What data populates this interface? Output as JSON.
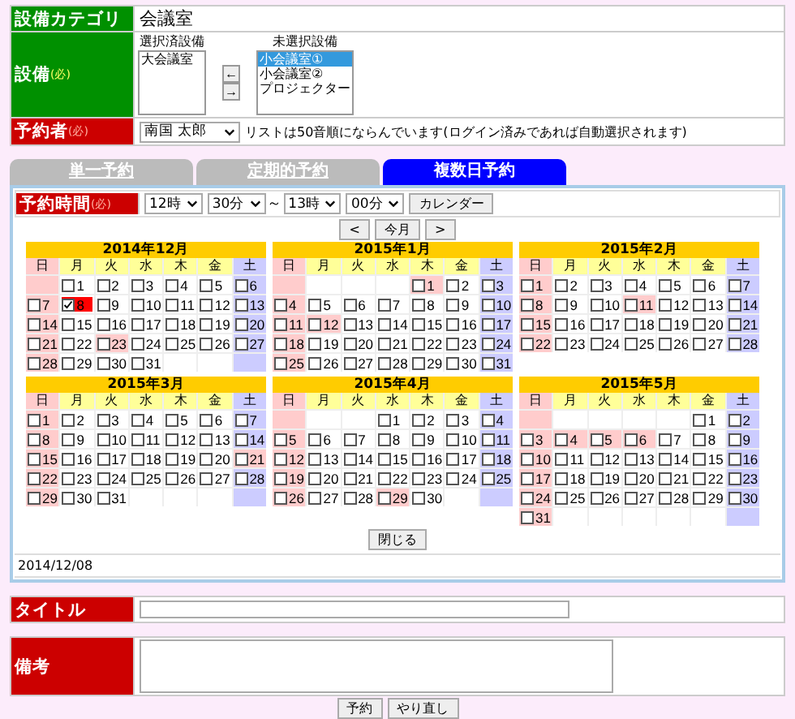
{
  "category": {
    "label": "設備カテゴリ",
    "value": "会議室"
  },
  "equipment": {
    "label": "設備",
    "required": "(必)",
    "selected_heading": "選択済設備",
    "unselected_heading": "未選択設備",
    "selected_list": [
      {
        "label": "大会議室",
        "selected": false
      }
    ],
    "move_buttons": [
      "←",
      "→"
    ],
    "unselected_list": [
      {
        "label": "小会議室①",
        "selected": true
      },
      {
        "label": "小会議室②",
        "selected": false
      },
      {
        "label": "プロジェクター",
        "selected": false
      }
    ]
  },
  "reserver": {
    "label": "予約者",
    "required": "(必)",
    "value": "南国 太郎",
    "note": "リストは50音順にならんでいます(ログイン済みであれば自動選択されます)"
  },
  "tabs": [
    {
      "label": "単一予約",
      "selected": false
    },
    {
      "label": "定期的予約",
      "selected": false
    },
    {
      "label": "複数日予約",
      "selected": true
    }
  ],
  "time": {
    "label": "予約時間",
    "required": "(必)",
    "start_hour": "12時",
    "start_min": "30分",
    "separator": "～",
    "end_hour": "13時",
    "end_min": "00分",
    "calendar_button": "カレンダー"
  },
  "nav": {
    "prev": "<",
    "today": "今月",
    "next": ">"
  },
  "months": [
    {
      "title": "2014年12月",
      "weekdays": [
        "日",
        "月",
        "火",
        "水",
        "木",
        "金",
        "土"
      ],
      "weeks": [
        [
          {
            "kind": "blank",
            "color": "#ffcccc"
          },
          {
            "kind": "day",
            "day": "1",
            "checked": false,
            "color": "#ffffff"
          },
          {
            "kind": "day",
            "day": "2",
            "checked": false,
            "color": "#ffffff"
          },
          {
            "kind": "day",
            "day": "3",
            "checked": false,
            "color": "#ffffff"
          },
          {
            "kind": "day",
            "day": "4",
            "checked": false,
            "color": "#ffffff"
          },
          {
            "kind": "day",
            "day": "5",
            "checked": false,
            "color": "#ffffff"
          },
          {
            "kind": "day",
            "day": "6",
            "checked": false,
            "color": "#ccccff"
          }
        ],
        [
          {
            "kind": "day",
            "day": "7",
            "checked": false,
            "color": "#ffcccc"
          },
          {
            "kind": "day",
            "day": "8",
            "checked": true,
            "color": "#ffffff"
          },
          {
            "kind": "day",
            "day": "9",
            "checked": false,
            "color": "#ffffff"
          },
          {
            "kind": "day",
            "day": "10",
            "checked": false,
            "color": "#ffffff"
          },
          {
            "kind": "day",
            "day": "11",
            "checked": false,
            "color": "#ffffff"
          },
          {
            "kind": "day",
            "day": "12",
            "checked": false,
            "color": "#ffffff"
          },
          {
            "kind": "day",
            "day": "13",
            "checked": false,
            "color": "#ccccff"
          }
        ],
        [
          {
            "kind": "day",
            "day": "14",
            "checked": false,
            "color": "#ffcccc"
          },
          {
            "kind": "day",
            "day": "15",
            "checked": false,
            "color": "#ffffff"
          },
          {
            "kind": "day",
            "day": "16",
            "checked": false,
            "color": "#ffffff"
          },
          {
            "kind": "day",
            "day": "17",
            "checked": false,
            "color": "#ffffff"
          },
          {
            "kind": "day",
            "day": "18",
            "checked": false,
            "color": "#ffffff"
          },
          {
            "kind": "day",
            "day": "19",
            "checked": false,
            "color": "#ffffff"
          },
          {
            "kind": "day",
            "day": "20",
            "checked": false,
            "color": "#ccccff"
          }
        ],
        [
          {
            "kind": "day",
            "day": "21",
            "checked": false,
            "color": "#ffcccc"
          },
          {
            "kind": "day",
            "day": "22",
            "checked": false,
            "color": "#ffffff"
          },
          {
            "kind": "day",
            "day": "23",
            "checked": false,
            "color": "#ffcccc"
          },
          {
            "kind": "day",
            "day": "24",
            "checked": false,
            "color": "#ffffff"
          },
          {
            "kind": "day",
            "day": "25",
            "checked": false,
            "color": "#ffffff"
          },
          {
            "kind": "day",
            "day": "26",
            "checked": false,
            "color": "#ffffff"
          },
          {
            "kind": "day",
            "day": "27",
            "checked": false,
            "color": "#ccccff"
          }
        ],
        [
          {
            "kind": "day",
            "day": "28",
            "checked": false,
            "color": "#ffcccc"
          },
          {
            "kind": "day",
            "day": "29",
            "checked": false,
            "color": "#ffffff"
          },
          {
            "kind": "day",
            "day": "30",
            "checked": false,
            "color": "#ffffff"
          },
          {
            "kind": "day",
            "day": "31",
            "checked": false,
            "color": "#ffffff"
          },
          {
            "kind": "blank",
            "color": "#ffffff"
          },
          {
            "kind": "blank",
            "color": "#ffffff"
          },
          {
            "kind": "blank",
            "color": "#ccccff"
          }
        ]
      ]
    },
    {
      "title": "2015年1月",
      "weekdays": [
        "日",
        "月",
        "火",
        "水",
        "木",
        "金",
        "土"
      ],
      "weeks": [
        [
          {
            "kind": "blank",
            "color": "#ffcccc"
          },
          {
            "kind": "blank",
            "color": "#ffffff"
          },
          {
            "kind": "blank",
            "color": "#ffffff"
          },
          {
            "kind": "blank",
            "color": "#ffffff"
          },
          {
            "kind": "day",
            "day": "1",
            "checked": false,
            "color": "#ffcccc"
          },
          {
            "kind": "day",
            "day": "2",
            "checked": false,
            "color": "#ffffff"
          },
          {
            "kind": "day",
            "day": "3",
            "checked": false,
            "color": "#ccccff"
          }
        ],
        [
          {
            "kind": "day",
            "day": "4",
            "checked": false,
            "color": "#ffcccc"
          },
          {
            "kind": "day",
            "day": "5",
            "checked": false,
            "color": "#ffffff"
          },
          {
            "kind": "day",
            "day": "6",
            "checked": false,
            "color": "#ffffff"
          },
          {
            "kind": "day",
            "day": "7",
            "checked": false,
            "color": "#ffffff"
          },
          {
            "kind": "day",
            "day": "8",
            "checked": false,
            "color": "#ffffff"
          },
          {
            "kind": "day",
            "day": "9",
            "checked": false,
            "color": "#ffffff"
          },
          {
            "kind": "day",
            "day": "10",
            "checked": false,
            "color": "#ccccff"
          }
        ],
        [
          {
            "kind": "day",
            "day": "11",
            "checked": false,
            "color": "#ffcccc"
          },
          {
            "kind": "day",
            "day": "12",
            "checked": false,
            "color": "#ffcccc"
          },
          {
            "kind": "day",
            "day": "13",
            "checked": false,
            "color": "#ffffff"
          },
          {
            "kind": "day",
            "day": "14",
            "checked": false,
            "color": "#ffffff"
          },
          {
            "kind": "day",
            "day": "15",
            "checked": false,
            "color": "#ffffff"
          },
          {
            "kind": "day",
            "day": "16",
            "checked": false,
            "color": "#ffffff"
          },
          {
            "kind": "day",
            "day": "17",
            "checked": false,
            "color": "#ccccff"
          }
        ],
        [
          {
            "kind": "day",
            "day": "18",
            "checked": false,
            "color": "#ffcccc"
          },
          {
            "kind": "day",
            "day": "19",
            "checked": false,
            "color": "#ffffff"
          },
          {
            "kind": "day",
            "day": "20",
            "checked": false,
            "color": "#ffffff"
          },
          {
            "kind": "day",
            "day": "21",
            "checked": false,
            "color": "#ffffff"
          },
          {
            "kind": "day",
            "day": "22",
            "checked": false,
            "color": "#ffffff"
          },
          {
            "kind": "day",
            "day": "23",
            "checked": false,
            "color": "#ffffff"
          },
          {
            "kind": "day",
            "day": "24",
            "checked": false,
            "color": "#ccccff"
          }
        ],
        [
          {
            "kind": "day",
            "day": "25",
            "checked": false,
            "color": "#ffcccc"
          },
          {
            "kind": "day",
            "day": "26",
            "checked": false,
            "color": "#ffffff"
          },
          {
            "kind": "day",
            "day": "27",
            "checked": false,
            "color": "#ffffff"
          },
          {
            "kind": "day",
            "day": "28",
            "checked": false,
            "color": "#ffffff"
          },
          {
            "kind": "day",
            "day": "29",
            "checked": false,
            "color": "#ffffff"
          },
          {
            "kind": "day",
            "day": "30",
            "checked": false,
            "color": "#ffffff"
          },
          {
            "kind": "day",
            "day": "31",
            "checked": false,
            "color": "#ccccff"
          }
        ]
      ]
    },
    {
      "title": "2015年2月",
      "weekdays": [
        "日",
        "月",
        "火",
        "水",
        "木",
        "金",
        "土"
      ],
      "weeks": [
        [
          {
            "kind": "day",
            "day": "1",
            "checked": false,
            "color": "#ffcccc"
          },
          {
            "kind": "day",
            "day": "2",
            "checked": false,
            "color": "#ffffff"
          },
          {
            "kind": "day",
            "day": "3",
            "checked": false,
            "color": "#ffffff"
          },
          {
            "kind": "day",
            "day": "4",
            "checked": false,
            "color": "#ffffff"
          },
          {
            "kind": "day",
            "day": "5",
            "checked": false,
            "color": "#ffffff"
          },
          {
            "kind": "day",
            "day": "6",
            "checked": false,
            "color": "#ffffff"
          },
          {
            "kind": "day",
            "day": "7",
            "checked": false,
            "color": "#ccccff"
          }
        ],
        [
          {
            "kind": "day",
            "day": "8",
            "checked": false,
            "color": "#ffcccc"
          },
          {
            "kind": "day",
            "day": "9",
            "checked": false,
            "color": "#ffffff"
          },
          {
            "kind": "day",
            "day": "10",
            "checked": false,
            "color": "#ffffff"
          },
          {
            "kind": "day",
            "day": "11",
            "checked": false,
            "color": "#ffcccc"
          },
          {
            "kind": "day",
            "day": "12",
            "checked": false,
            "color": "#ffffff"
          },
          {
            "kind": "day",
            "day": "13",
            "checked": false,
            "color": "#ffffff"
          },
          {
            "kind": "day",
            "day": "14",
            "checked": false,
            "color": "#ccccff"
          }
        ],
        [
          {
            "kind": "day",
            "day": "15",
            "checked": false,
            "color": "#ffcccc"
          },
          {
            "kind": "day",
            "day": "16",
            "checked": false,
            "color": "#ffffff"
          },
          {
            "kind": "day",
            "day": "17",
            "checked": false,
            "color": "#ffffff"
          },
          {
            "kind": "day",
            "day": "18",
            "checked": false,
            "color": "#ffffff"
          },
          {
            "kind": "day",
            "day": "19",
            "checked": false,
            "color": "#ffffff"
          },
          {
            "kind": "day",
            "day": "20",
            "checked": false,
            "color": "#ffffff"
          },
          {
            "kind": "day",
            "day": "21",
            "checked": false,
            "color": "#ccccff"
          }
        ],
        [
          {
            "kind": "day",
            "day": "22",
            "checked": false,
            "color": "#ffcccc"
          },
          {
            "kind": "day",
            "day": "23",
            "checked": false,
            "color": "#ffffff"
          },
          {
            "kind": "day",
            "day": "24",
            "checked": false,
            "color": "#ffffff"
          },
          {
            "kind": "day",
            "day": "25",
            "checked": false,
            "color": "#ffffff"
          },
          {
            "kind": "day",
            "day": "26",
            "checked": false,
            "color": "#ffffff"
          },
          {
            "kind": "day",
            "day": "27",
            "checked": false,
            "color": "#ffffff"
          },
          {
            "kind": "day",
            "day": "28",
            "checked": false,
            "color": "#ccccff"
          }
        ]
      ]
    },
    {
      "title": "2015年3月",
      "weekdays": [
        "日",
        "月",
        "火",
        "水",
        "木",
        "金",
        "土"
      ],
      "weeks": [
        [
          {
            "kind": "day",
            "day": "1",
            "checked": false,
            "color": "#ffcccc"
          },
          {
            "kind": "day",
            "day": "2",
            "checked": false,
            "color": "#ffffff"
          },
          {
            "kind": "day",
            "day": "3",
            "checked": false,
            "color": "#ffffff"
          },
          {
            "kind": "day",
            "day": "4",
            "checked": false,
            "color": "#ffffff"
          },
          {
            "kind": "day",
            "day": "5",
            "checked": false,
            "color": "#ffffff"
          },
          {
            "kind": "day",
            "day": "6",
            "checked": false,
            "color": "#ffffff"
          },
          {
            "kind": "day",
            "day": "7",
            "checked": false,
            "color": "#ccccff"
          }
        ],
        [
          {
            "kind": "day",
            "day": "8",
            "checked": false,
            "color": "#ffcccc"
          },
          {
            "kind": "day",
            "day": "9",
            "checked": false,
            "color": "#ffffff"
          },
          {
            "kind": "day",
            "day": "10",
            "checked": false,
            "color": "#ffffff"
          },
          {
            "kind": "day",
            "day": "11",
            "checked": false,
            "color": "#ffffff"
          },
          {
            "kind": "day",
            "day": "12",
            "checked": false,
            "color": "#ffffff"
          },
          {
            "kind": "day",
            "day": "13",
            "checked": false,
            "color": "#ffffff"
          },
          {
            "kind": "day",
            "day": "14",
            "checked": false,
            "color": "#ccccff"
          }
        ],
        [
          {
            "kind": "day",
            "day": "15",
            "checked": false,
            "color": "#ffcccc"
          },
          {
            "kind": "day",
            "day": "16",
            "checked": false,
            "color": "#ffffff"
          },
          {
            "kind": "day",
            "day": "17",
            "checked": false,
            "color": "#ffffff"
          },
          {
            "kind": "day",
            "day": "18",
            "checked": false,
            "color": "#ffffff"
          },
          {
            "kind": "day",
            "day": "19",
            "checked": false,
            "color": "#ffffff"
          },
          {
            "kind": "day",
            "day": "20",
            "checked": false,
            "color": "#ffffff"
          },
          {
            "kind": "day",
            "day": "21",
            "checked": false,
            "color": "#ffcccc"
          }
        ],
        [
          {
            "kind": "day",
            "day": "22",
            "checked": false,
            "color": "#ffcccc"
          },
          {
            "kind": "day",
            "day": "23",
            "checked": false,
            "color": "#ffffff"
          },
          {
            "kind": "day",
            "day": "24",
            "checked": false,
            "color": "#ffffff"
          },
          {
            "kind": "day",
            "day": "25",
            "checked": false,
            "color": "#ffffff"
          },
          {
            "kind": "day",
            "day": "26",
            "checked": false,
            "color": "#ffffff"
          },
          {
            "kind": "day",
            "day": "27",
            "checked": false,
            "color": "#ffffff"
          },
          {
            "kind": "day",
            "day": "28",
            "checked": false,
            "color": "#ccccff"
          }
        ],
        [
          {
            "kind": "day",
            "day": "29",
            "checked": false,
            "color": "#ffcccc"
          },
          {
            "kind": "day",
            "day": "30",
            "checked": false,
            "color": "#ffffff"
          },
          {
            "kind": "day",
            "day": "31",
            "checked": false,
            "color": "#ffffff"
          },
          {
            "kind": "blank",
            "color": "#ffffff"
          },
          {
            "kind": "blank",
            "color": "#ffffff"
          },
          {
            "kind": "blank",
            "color": "#ffffff"
          },
          {
            "kind": "blank",
            "color": "#ccccff"
          }
        ]
      ]
    },
    {
      "title": "2015年4月",
      "weekdays": [
        "日",
        "月",
        "火",
        "水",
        "木",
        "金",
        "土"
      ],
      "weeks": [
        [
          {
            "kind": "blank",
            "color": "#ffcccc"
          },
          {
            "kind": "blank",
            "color": "#ffffff"
          },
          {
            "kind": "blank",
            "color": "#ffffff"
          },
          {
            "kind": "day",
            "day": "1",
            "checked": false,
            "color": "#ffffff"
          },
          {
            "kind": "day",
            "day": "2",
            "checked": false,
            "color": "#ffffff"
          },
          {
            "kind": "day",
            "day": "3",
            "checked": false,
            "color": "#ffffff"
          },
          {
            "kind": "day",
            "day": "4",
            "checked": false,
            "color": "#ccccff"
          }
        ],
        [
          {
            "kind": "day",
            "day": "5",
            "checked": false,
            "color": "#ffcccc"
          },
          {
            "kind": "day",
            "day": "6",
            "checked": false,
            "color": "#ffffff"
          },
          {
            "kind": "day",
            "day": "7",
            "checked": false,
            "color": "#ffffff"
          },
          {
            "kind": "day",
            "day": "8",
            "checked": false,
            "color": "#ffffff"
          },
          {
            "kind": "day",
            "day": "9",
            "checked": false,
            "color": "#ffffff"
          },
          {
            "kind": "day",
            "day": "10",
            "checked": false,
            "color": "#ffffff"
          },
          {
            "kind": "day",
            "day": "11",
            "checked": false,
            "color": "#ccccff"
          }
        ],
        [
          {
            "kind": "day",
            "day": "12",
            "checked": false,
            "color": "#ffcccc"
          },
          {
            "kind": "day",
            "day": "13",
            "checked": false,
            "color": "#ffffff"
          },
          {
            "kind": "day",
            "day": "14",
            "checked": false,
            "color": "#ffffff"
          },
          {
            "kind": "day",
            "day": "15",
            "checked": false,
            "color": "#ffffff"
          },
          {
            "kind": "day",
            "day": "16",
            "checked": false,
            "color": "#ffffff"
          },
          {
            "kind": "day",
            "day": "17",
            "checked": false,
            "color": "#ffffff"
          },
          {
            "kind": "day",
            "day": "18",
            "checked": false,
            "color": "#ccccff"
          }
        ],
        [
          {
            "kind": "day",
            "day": "19",
            "checked": false,
            "color": "#ffcccc"
          },
          {
            "kind": "day",
            "day": "20",
            "checked": false,
            "color": "#ffffff"
          },
          {
            "kind": "day",
            "day": "21",
            "checked": false,
            "color": "#ffffff"
          },
          {
            "kind": "day",
            "day": "22",
            "checked": false,
            "color": "#ffffff"
          },
          {
            "kind": "day",
            "day": "23",
            "checked": false,
            "color": "#ffffff"
          },
          {
            "kind": "day",
            "day": "24",
            "checked": false,
            "color": "#ffffff"
          },
          {
            "kind": "day",
            "day": "25",
            "checked": false,
            "color": "#ccccff"
          }
        ],
        [
          {
            "kind": "day",
            "day": "26",
            "checked": false,
            "color": "#ffcccc"
          },
          {
            "kind": "day",
            "day": "27",
            "checked": false,
            "color": "#ffffff"
          },
          {
            "kind": "day",
            "day": "28",
            "checked": false,
            "color": "#ffffff"
          },
          {
            "kind": "day",
            "day": "29",
            "checked": false,
            "color": "#ffcccc"
          },
          {
            "kind": "day",
            "day": "30",
            "checked": false,
            "color": "#ffffff"
          },
          {
            "kind": "blank",
            "color": "#ffffff"
          },
          {
            "kind": "blank",
            "color": "#ccccff"
          }
        ]
      ]
    },
    {
      "title": "2015年5月",
      "weekdays": [
        "日",
        "月",
        "火",
        "水",
        "木",
        "金",
        "土"
      ],
      "weeks": [
        [
          {
            "kind": "blank",
            "color": "#ffcccc"
          },
          {
            "kind": "blank",
            "color": "#ffffff"
          },
          {
            "kind": "blank",
            "color": "#ffffff"
          },
          {
            "kind": "blank",
            "color": "#ffffff"
          },
          {
            "kind": "blank",
            "color": "#ffffff"
          },
          {
            "kind": "day",
            "day": "1",
            "checked": false,
            "color": "#ffffff"
          },
          {
            "kind": "day",
            "day": "2",
            "checked": false,
            "color": "#ccccff"
          }
        ],
        [
          {
            "kind": "day",
            "day": "3",
            "checked": false,
            "color": "#ffcccc"
          },
          {
            "kind": "day",
            "day": "4",
            "checked": false,
            "color": "#ffcccc"
          },
          {
            "kind": "day",
            "day": "5",
            "checked": false,
            "color": "#ffcccc"
          },
          {
            "kind": "day",
            "day": "6",
            "checked": false,
            "color": "#ffcccc"
          },
          {
            "kind": "day",
            "day": "7",
            "checked": false,
            "color": "#ffffff"
          },
          {
            "kind": "day",
            "day": "8",
            "checked": false,
            "color": "#ffffff"
          },
          {
            "kind": "day",
            "day": "9",
            "checked": false,
            "color": "#ccccff"
          }
        ],
        [
          {
            "kind": "day",
            "day": "10",
            "checked": false,
            "color": "#ffcccc"
          },
          {
            "kind": "day",
            "day": "11",
            "checked": false,
            "color": "#ffffff"
          },
          {
            "kind": "day",
            "day": "12",
            "checked": false,
            "color": "#ffffff"
          },
          {
            "kind": "day",
            "day": "13",
            "checked": false,
            "color": "#ffffff"
          },
          {
            "kind": "day",
            "day": "14",
            "checked": false,
            "color": "#ffffff"
          },
          {
            "kind": "day",
            "day": "15",
            "checked": false,
            "color": "#ffffff"
          },
          {
            "kind": "day",
            "day": "16",
            "checked": false,
            "color": "#ccccff"
          }
        ],
        [
          {
            "kind": "day",
            "day": "17",
            "checked": false,
            "color": "#ffcccc"
          },
          {
            "kind": "day",
            "day": "18",
            "checked": false,
            "color": "#ffffff"
          },
          {
            "kind": "day",
            "day": "19",
            "checked": false,
            "color": "#ffffff"
          },
          {
            "kind": "day",
            "day": "20",
            "checked": false,
            "color": "#ffffff"
          },
          {
            "kind": "day",
            "day": "21",
            "checked": false,
            "color": "#ffffff"
          },
          {
            "kind": "day",
            "day": "22",
            "checked": false,
            "color": "#ffffff"
          },
          {
            "kind": "day",
            "day": "23",
            "checked": false,
            "color": "#ccccff"
          }
        ],
        [
          {
            "kind": "day",
            "day": "24",
            "checked": false,
            "color": "#ffcccc"
          },
          {
            "kind": "day",
            "day": "25",
            "checked": false,
            "color": "#ffffff"
          },
          {
            "kind": "day",
            "day": "26",
            "checked": false,
            "color": "#ffffff"
          },
          {
            "kind": "day",
            "day": "27",
            "checked": false,
            "color": "#ffffff"
          },
          {
            "kind": "day",
            "day": "28",
            "checked": false,
            "color": "#ffffff"
          },
          {
            "kind": "day",
            "day": "29",
            "checked": false,
            "color": "#ffffff"
          },
          {
            "kind": "day",
            "day": "30",
            "checked": false,
            "color": "#ccccff"
          }
        ],
        [
          {
            "kind": "day",
            "day": "31",
            "checked": false,
            "color": "#ffcccc"
          },
          {
            "kind": "blank",
            "color": "#ffffff"
          },
          {
            "kind": "blank",
            "color": "#ffffff"
          },
          {
            "kind": "blank",
            "color": "#ffffff"
          },
          {
            "kind": "blank",
            "color": "#ffffff"
          },
          {
            "kind": "blank",
            "color": "#ffffff"
          },
          {
            "kind": "blank",
            "color": "#ccccff"
          }
        ]
      ]
    }
  ],
  "close_button": "閉じる",
  "selected_dates": "2014/12/08",
  "title_field": {
    "label": "タイトル"
  },
  "remarks_field": {
    "label": "備考"
  },
  "buttons": [
    "予約",
    "やり直し"
  ]
}
